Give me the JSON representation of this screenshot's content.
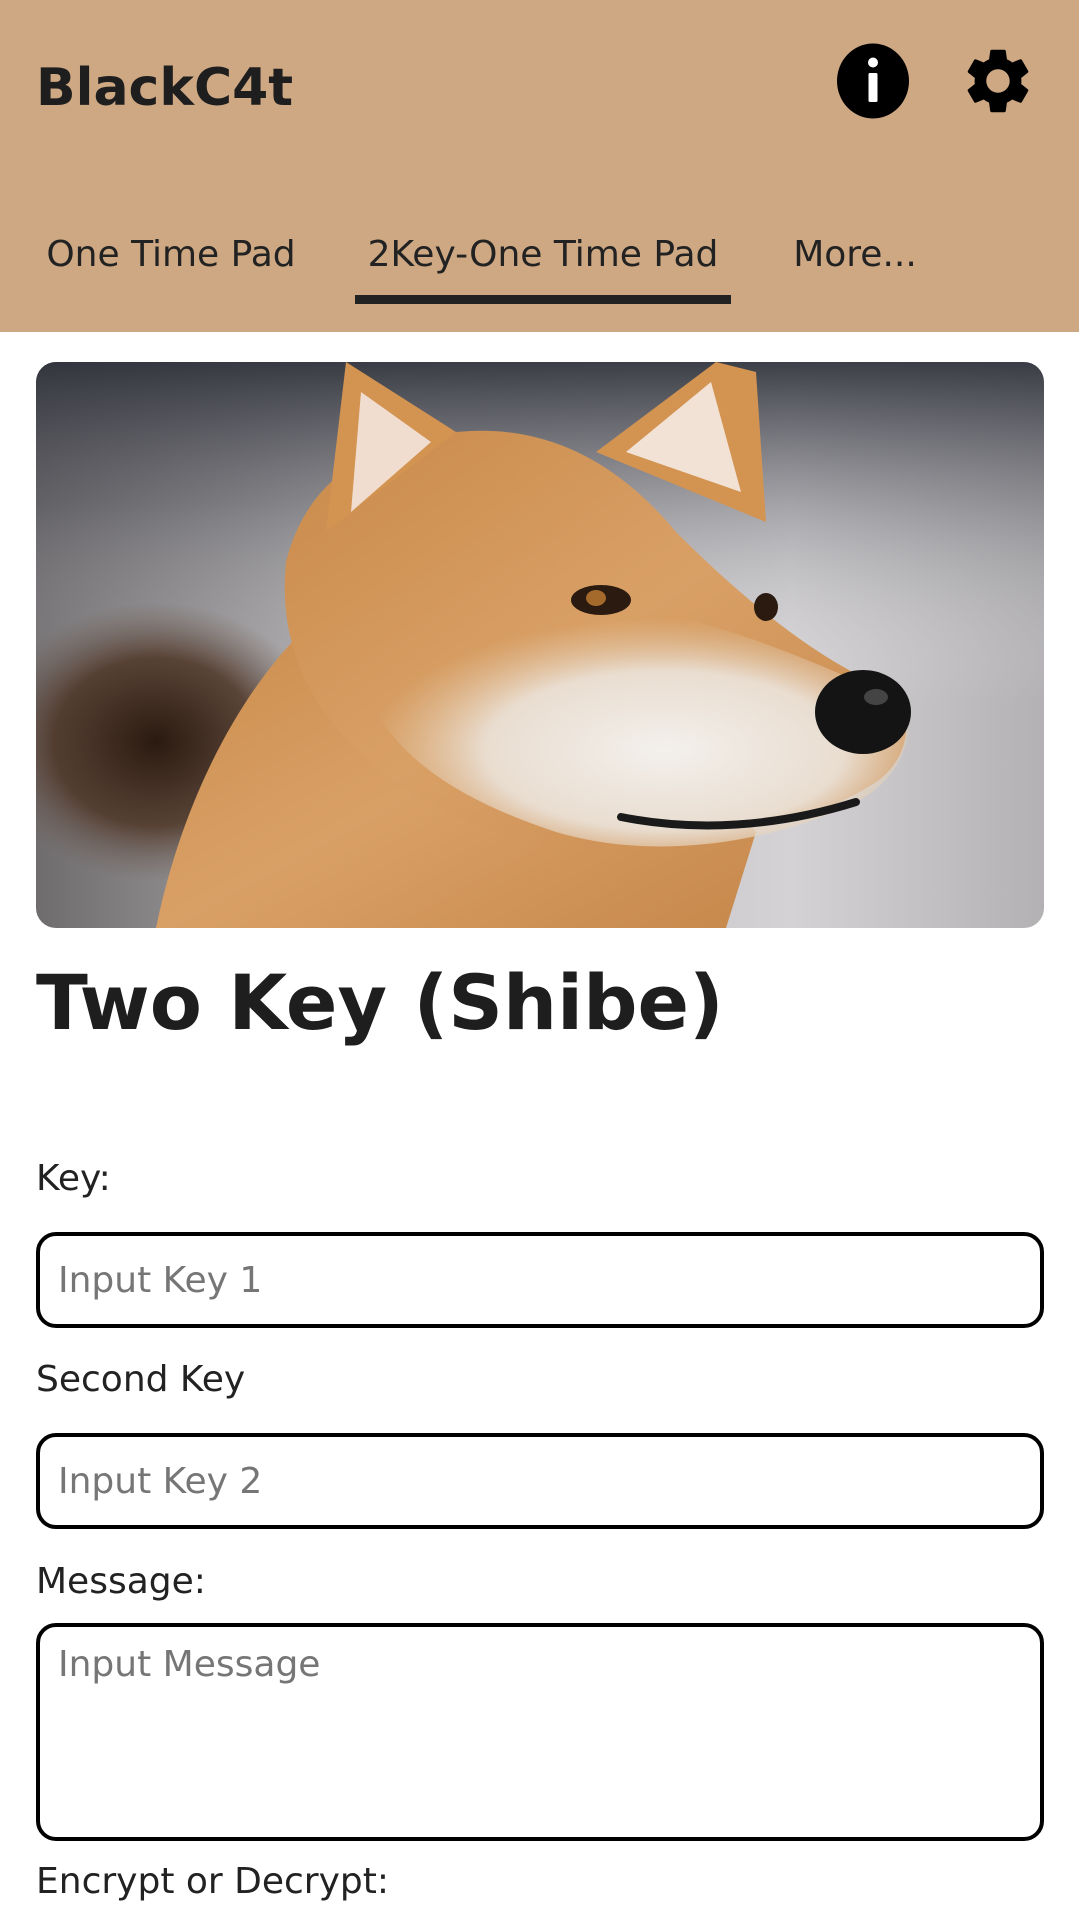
{
  "app": {
    "title": "BlackC4t",
    "info_icon": "info-icon",
    "settings_icon": "gear-icon",
    "accent_color": "#cea883"
  },
  "tabs": [
    {
      "label": "One Time Pad",
      "selected": false
    },
    {
      "label": "2Key-One Time Pad",
      "selected": true
    },
    {
      "label": "More...",
      "selected": false
    }
  ],
  "hero_image": {
    "subject": "shiba-inu-photo"
  },
  "main": {
    "title": "Two Key (Shibe)"
  },
  "form": {
    "key_label": "Key:",
    "key1_placeholder": "Input Key 1",
    "key1_value": "",
    "second_key_label": "Second Key",
    "key2_placeholder": "Input Key 2",
    "key2_value": "",
    "message_label": "Message:",
    "message_placeholder": "Input Message",
    "message_value": "",
    "mode_label": "Encrypt or Decrypt:"
  }
}
